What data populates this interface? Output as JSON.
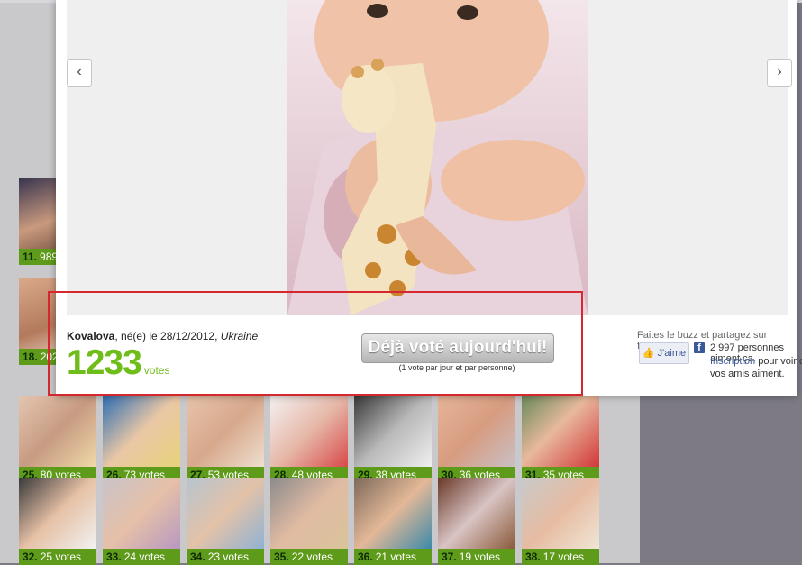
{
  "thumbnails_left": [
    {
      "num": "11.",
      "votes": "989"
    },
    {
      "num": "18.",
      "votes": "202"
    }
  ],
  "thumbnails_row3": [
    {
      "num": "25.",
      "votes": "80 votes"
    },
    {
      "num": "26.",
      "votes": "73 votes"
    },
    {
      "num": "27.",
      "votes": "53 votes"
    },
    {
      "num": "28.",
      "votes": "48 votes"
    },
    {
      "num": "29.",
      "votes": "38 votes"
    },
    {
      "num": "30.",
      "votes": "36 votes"
    },
    {
      "num": "31.",
      "votes": "35 votes"
    }
  ],
  "thumbnails_row4": [
    {
      "num": "32.",
      "votes": "25 votes"
    },
    {
      "num": "33.",
      "votes": "24 votes"
    },
    {
      "num": "34.",
      "votes": "23 votes"
    },
    {
      "num": "35.",
      "votes": "22 votes"
    },
    {
      "num": "36.",
      "votes": "21 votes"
    },
    {
      "num": "37.",
      "votes": "19 votes"
    },
    {
      "num": "38.",
      "votes": "17 votes"
    }
  ],
  "entry": {
    "name": "Kovalova",
    "born": ", né(e) le 28/12/2012, ",
    "country": "Ukraine",
    "votes_count": "1233",
    "votes_label": "votes"
  },
  "vote": {
    "button_label": "Déjà voté aujourd'hui!",
    "note": "(1 vote par jour et par personne)"
  },
  "facebook": {
    "title": "Faites le buzz et partagez sur facebook :",
    "like_label": "J'aime",
    "count_text": "2 997 personnes aiment ça.",
    "signup_link": "Inscription",
    "signup_rest": " pour voir ce que vos amis aiment."
  },
  "colors": {
    "accent_green": "#6fbd19",
    "caption_green": "#5f9b1a",
    "highlight_red": "#d6262e",
    "facebook_blue": "#3b5998"
  },
  "icons": {
    "prev": "chevron-left-icon",
    "next": "chevron-right-icon",
    "like": "thumbs-up-icon",
    "facebook": "facebook-icon"
  }
}
